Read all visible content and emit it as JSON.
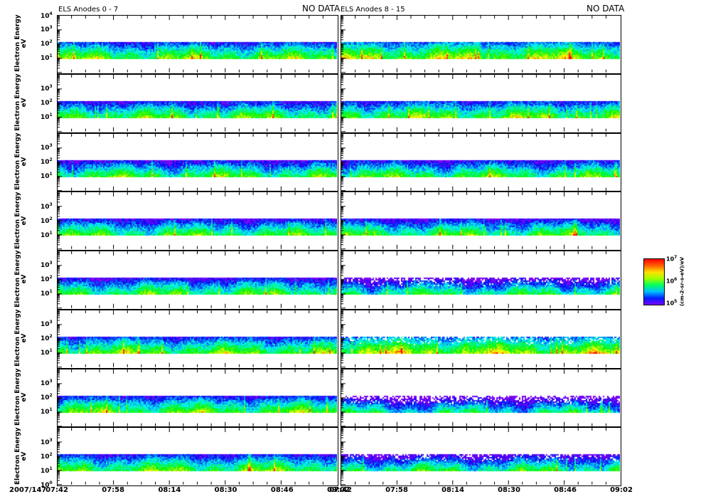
{
  "chart_data": {
    "type": "heatmap",
    "left_title": "ELS Anodes 0 - 7",
    "right_title": "ELS Anodes 8 - 15",
    "left_status": "NO DATA",
    "right_status": "NO DATA",
    "ylabel": "Electron Energy",
    "yunit": "eV",
    "yscale": "log",
    "ylim": [
      1,
      10000
    ],
    "y_tick_exponents_top": [
      "4",
      "3",
      "2",
      "1"
    ],
    "y_tick_exponents": [
      "3",
      "2",
      "1"
    ],
    "y_tick_exponents_bottom": [
      "3",
      "2",
      "1",
      "0"
    ],
    "date_label": "2007/147",
    "x_ticks": [
      "07:42",
      "07:58",
      "08:14",
      "08:30",
      "08:46",
      "09:02"
    ],
    "xlim": [
      "07:42",
      "09:02"
    ],
    "energy_band_eV": [
      10,
      140
    ],
    "colorbar": {
      "label": "(cm-2-sr-s-eV)/eV",
      "tick_exponents": [
        "7",
        "6",
        "5"
      ],
      "colormap": "rainbow"
    },
    "panels": [
      {
        "group": "left",
        "anode": 0,
        "level": 0.62,
        "dropout": 0.0
      },
      {
        "group": "right",
        "anode": 8,
        "level": 0.7,
        "dropout": 0.0
      },
      {
        "group": "left",
        "anode": 1,
        "level": 0.58,
        "dropout": 0.0
      },
      {
        "group": "right",
        "anode": 9,
        "level": 0.62,
        "dropout": 0.0
      },
      {
        "group": "left",
        "anode": 2,
        "level": 0.56,
        "dropout": 0.0
      },
      {
        "group": "right",
        "anode": 10,
        "level": 0.56,
        "dropout": 0.0
      },
      {
        "group": "left",
        "anode": 3,
        "level": 0.55,
        "dropout": 0.0
      },
      {
        "group": "right",
        "anode": 11,
        "level": 0.55,
        "dropout": 0.0
      },
      {
        "group": "left",
        "anode": 4,
        "level": 0.56,
        "dropout": 0.0
      },
      {
        "group": "right",
        "anode": 12,
        "level": 0.48,
        "dropout": 0.25
      },
      {
        "group": "left",
        "anode": 5,
        "level": 0.62,
        "dropout": 0.0
      },
      {
        "group": "right",
        "anode": 13,
        "level": 0.72,
        "dropout": 0.2
      },
      {
        "group": "left",
        "anode": 6,
        "level": 0.6,
        "dropout": 0.0
      },
      {
        "group": "right",
        "anode": 14,
        "level": 0.42,
        "dropout": 0.45
      },
      {
        "group": "left",
        "anode": 7,
        "level": 0.6,
        "dropout": 0.0
      },
      {
        "group": "right",
        "anode": 15,
        "level": 0.5,
        "dropout": 0.2
      }
    ]
  }
}
